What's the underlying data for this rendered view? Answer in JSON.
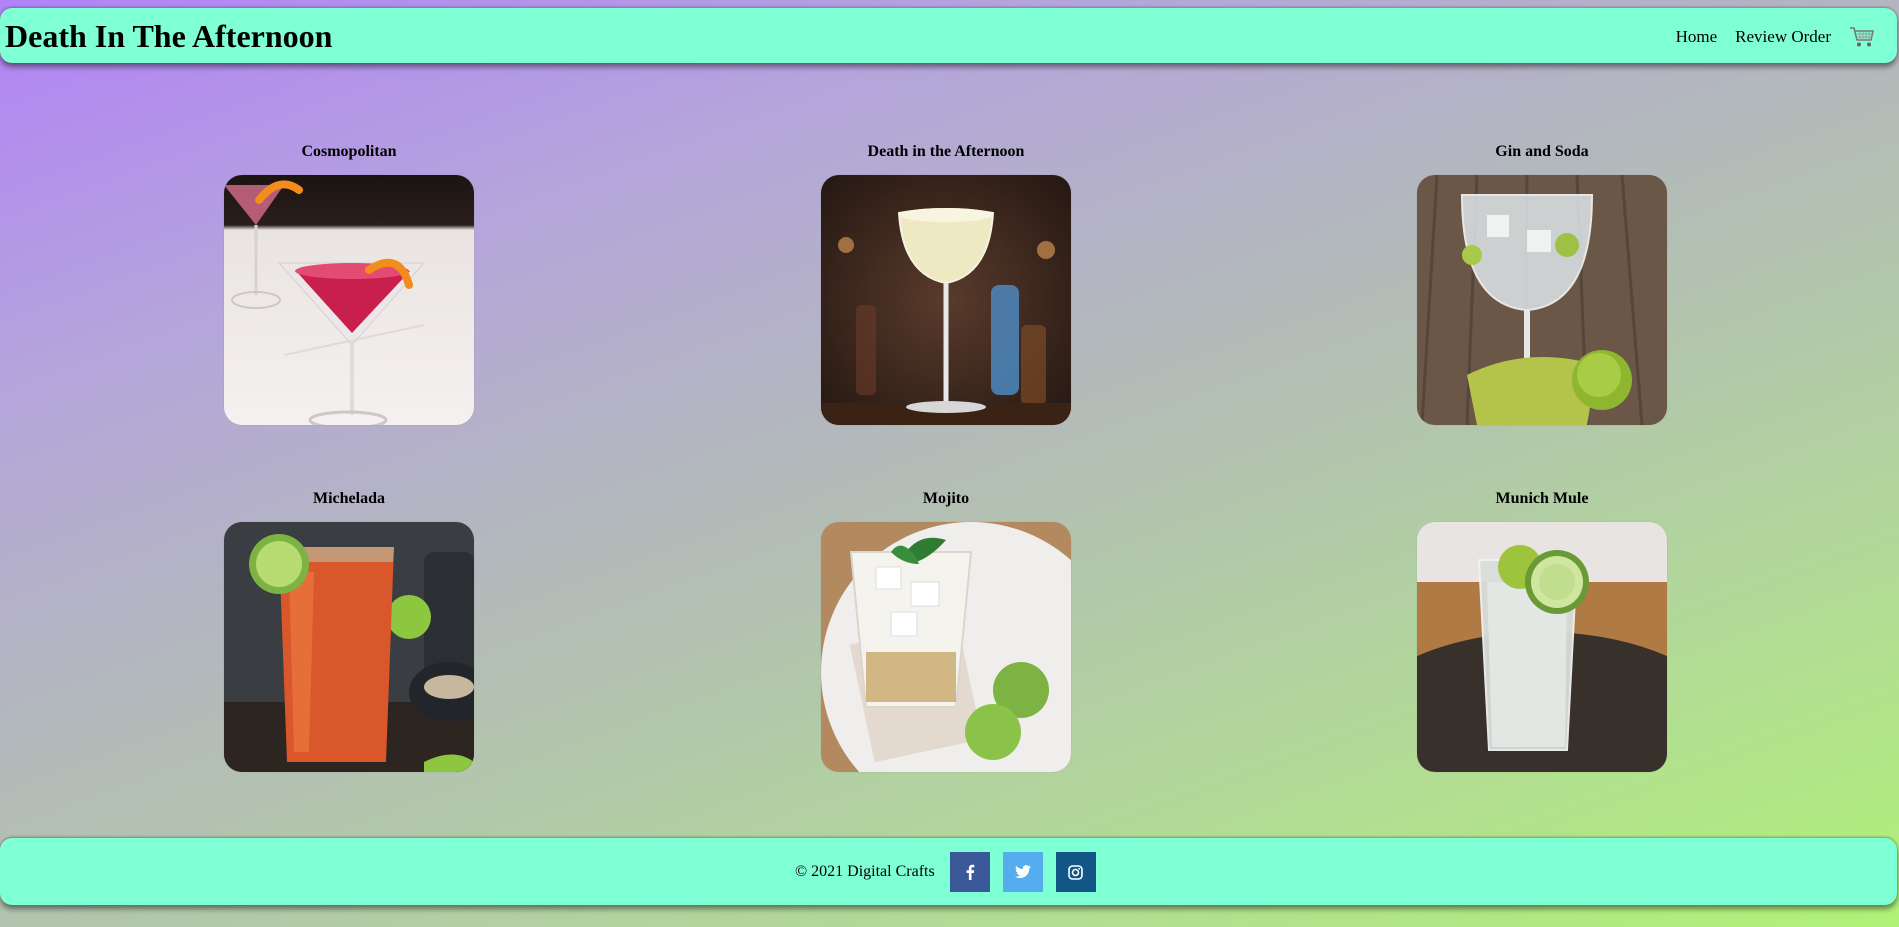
{
  "header": {
    "brand": "Death In The Afternoon",
    "nav": {
      "home": "Home",
      "review": "Review Order"
    },
    "cart_icon": "shopping-cart-icon"
  },
  "drinks": [
    {
      "name": "Cosmopolitan"
    },
    {
      "name": "Death in the Afternoon"
    },
    {
      "name": "Gin and Soda"
    },
    {
      "name": "Michelada"
    },
    {
      "name": "Mojito"
    },
    {
      "name": "Munich Mule"
    }
  ],
  "footer": {
    "copyright": "© 2021 Digital Crafts",
    "social": [
      {
        "name": "facebook-icon",
        "color": "#3b5998",
        "glyph": "f"
      },
      {
        "name": "twitter-icon",
        "color": "#55acee",
        "glyph": "t"
      },
      {
        "name": "instagram-icon",
        "color": "#125688",
        "glyph": "i"
      }
    ]
  },
  "colors": {
    "bar": "#7fffd4",
    "gradient_start": "#b282f7",
    "gradient_end": "#b0f277"
  }
}
